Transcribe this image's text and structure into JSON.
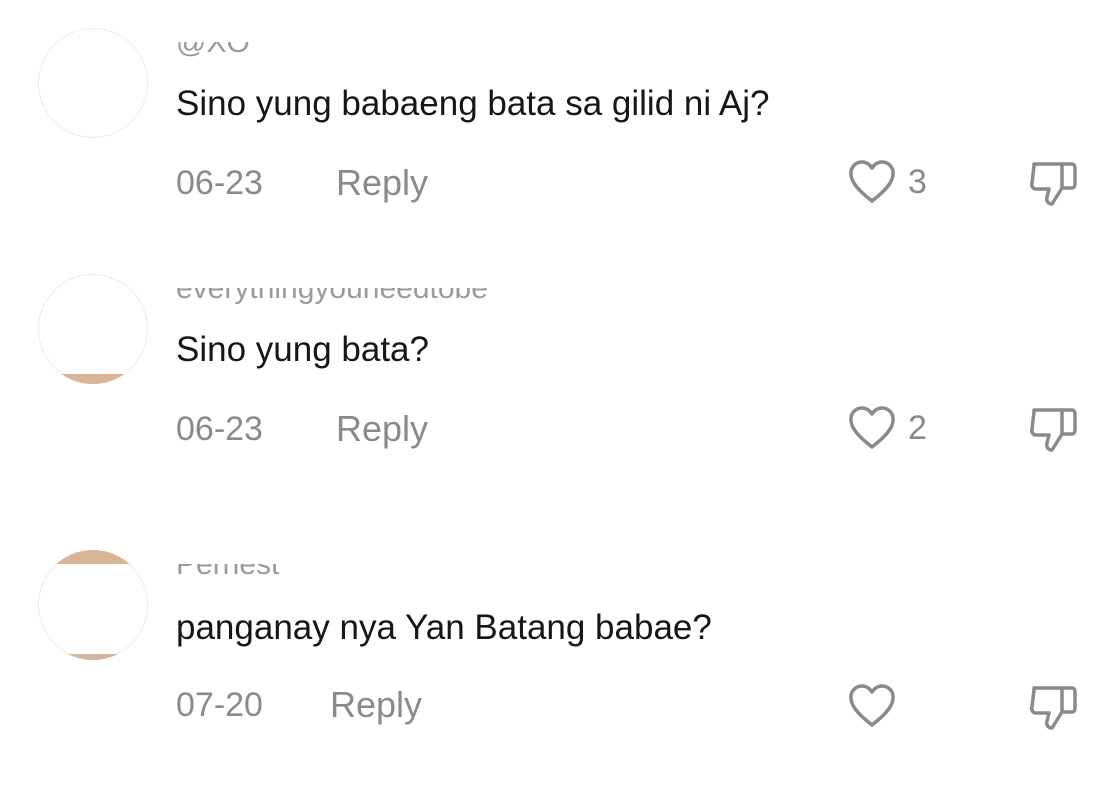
{
  "comments": [
    {
      "username": "@XO",
      "text": "Sino yung babaeng bata sa gilid ni Aj?",
      "date": "06-23",
      "reply_label": "Reply",
      "likes": "3"
    },
    {
      "username": "everythingyouneedtobe",
      "text": "Sino yung bata?",
      "date": "06-23",
      "reply_label": "Reply",
      "likes": "2"
    },
    {
      "username": "Pernest",
      "text": "panganay nya Yan Batang babae?",
      "date": "07-20",
      "reply_label": "Reply",
      "likes": ""
    }
  ],
  "icons": {
    "like": "heart-outline-icon",
    "dislike": "thumbs-down-outline-icon"
  },
  "colors": {
    "text": "#161616",
    "meta": "#8a8a8a",
    "avatar_tone": "#d8b596"
  }
}
